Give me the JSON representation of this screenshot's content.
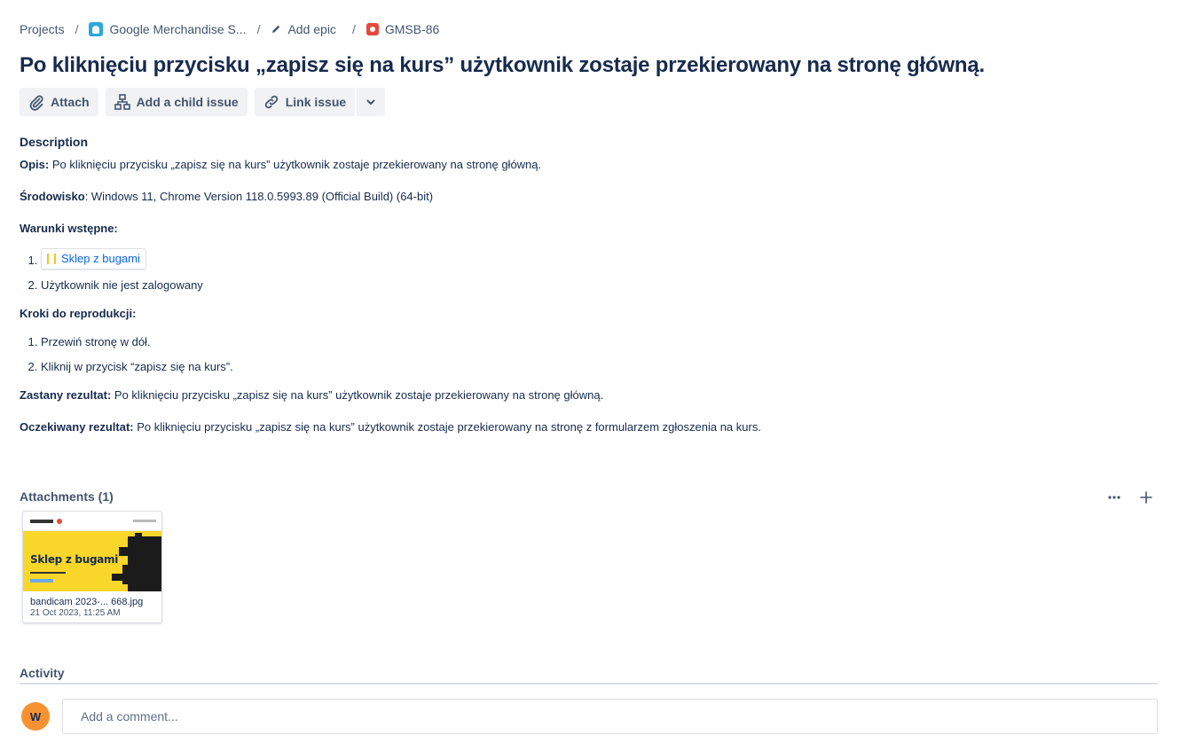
{
  "breadcrumb": {
    "projects": "Projects",
    "project": "Google Merchandise S...",
    "epic": "Add epic",
    "issue_key": "GMSB-86"
  },
  "issue": {
    "title": "Po kliknięciu przycisku „zapisz się na kurs” użytkownik zostaje przekierowany na stronę główną."
  },
  "toolbar": {
    "attach": "Attach",
    "add_child": "Add a child issue",
    "link_issue": "Link issue"
  },
  "description": {
    "heading": "Description",
    "opis_label": "Opis:",
    "opis_text": " Po kliknięciu przycisku „zapisz się na kurs” użytkownik zostaje przekierowany na stronę główną.",
    "srodowisko_label": "Środowisko",
    "srodowisko_text": ": Windows 11, Chrome Version 118.0.5993.89 (Official Build) (64-bit)",
    "warunki_label": "Warunki wstępne:",
    "warunki_items": [
      "Sklep z bugami",
      "Użytkownik nie jest zalogowany"
    ],
    "kroki_label": "Kroki do reprodukcji:",
    "kroki_items": [
      "Przewiń stronę w dół.",
      "Kliknij w przycisk “zapisz się na kurs”."
    ],
    "zastany_label": "Zastany rezultat:",
    "zastany_text": " Po kliknięciu przycisku „zapisz się na kurs” użytkownik zostaje przekierowany na stronę główną.",
    "oczekiwany_label": "Oczekiwany rezultat:",
    "oczekiwany_text": " Po kliknięciu przycisku „zapisz się na kurs” użytkownik zostaje przekierowany na stronę z formularzem zgłoszenia na kurs."
  },
  "attachments": {
    "heading": "Attachments (1)",
    "items": [
      {
        "thumb_text": "Sklep z bugami",
        "name": "bandicam 2023-... 668.jpg",
        "date": "21 Oct 2023, 11:25 AM"
      }
    ]
  },
  "activity": {
    "heading": "Activity",
    "avatar_initial": "W",
    "comment_placeholder": "Add a comment..."
  },
  "colors": {
    "accent": "#0c66e4",
    "avatar": "#f79232",
    "bug": "#e5493a",
    "project": "#2aa8d9"
  }
}
